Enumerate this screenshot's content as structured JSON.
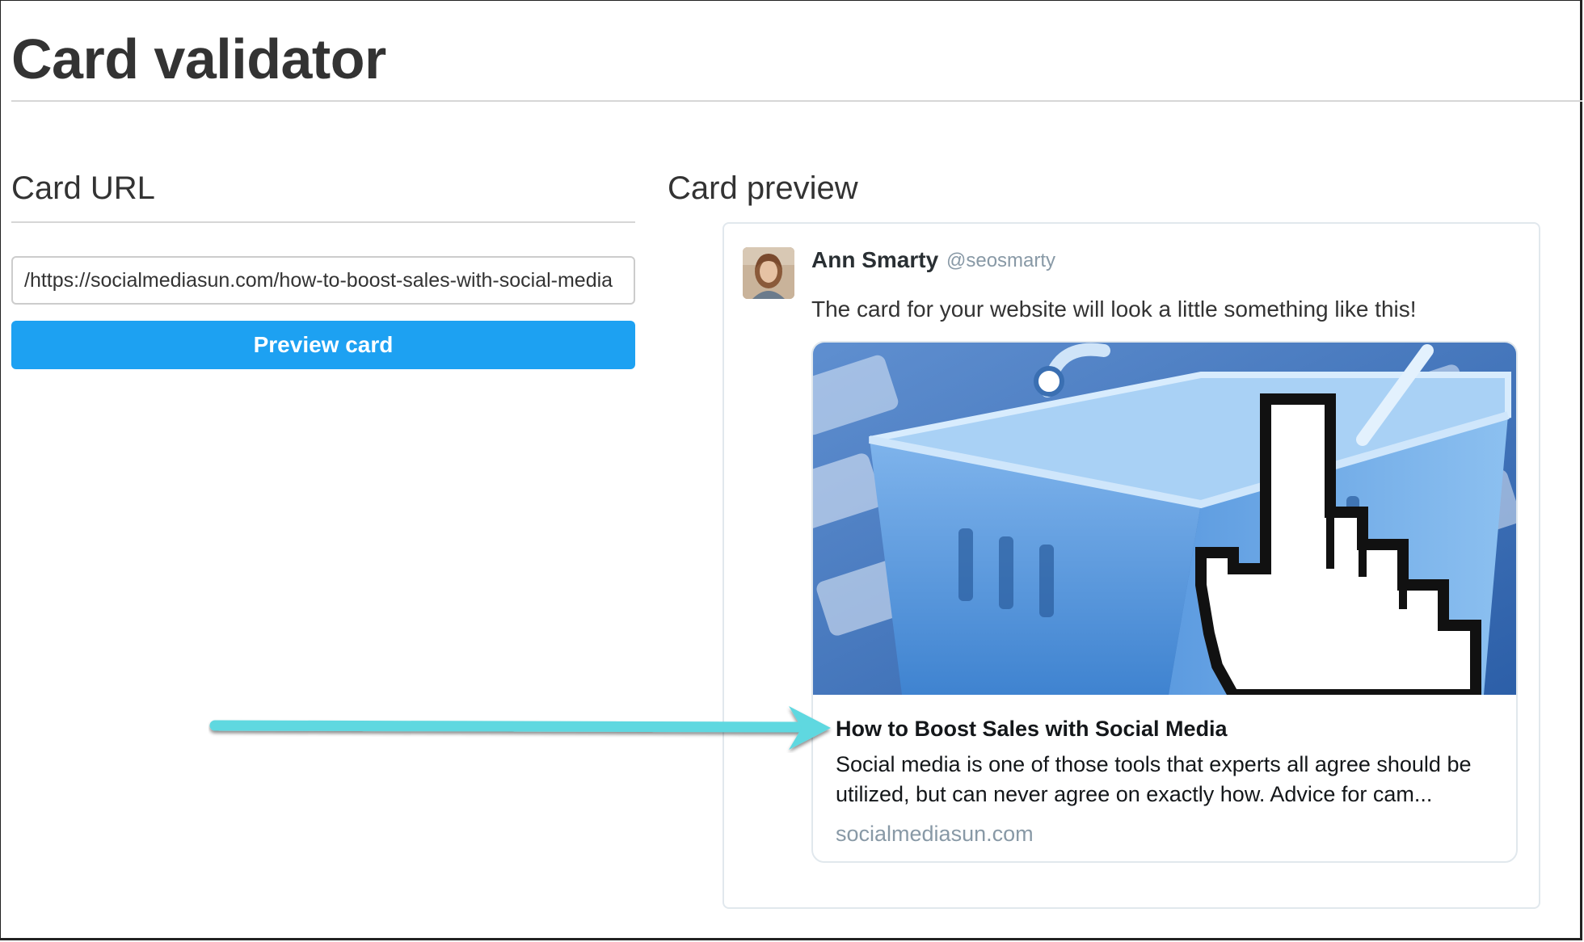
{
  "page": {
    "title": "Card validator"
  },
  "card_url": {
    "heading": "Card URL",
    "input_value": "https://socialmediasun.com/how-to-boost-sales-with-social-media/",
    "button_label": "Preview card"
  },
  "card_preview": {
    "heading": "Card preview",
    "tweet": {
      "author_name": "Ann Smarty",
      "author_handle": "@seosmarty",
      "text": "The card for your website will look a little something like this!"
    },
    "link_card": {
      "title": "How to Boost Sales with Social Media",
      "description": "Social media is one of those tools that experts all agree should be utilized, but can never agree on exactly how. Advice for cam...",
      "domain": "socialmediasun.com"
    }
  },
  "colors": {
    "button_blue": "#1da1f2",
    "annotation_arrow": "#5ed8e0",
    "basket_blue": "#4a8fd6"
  },
  "icons": {
    "card_image": "shopping-basket-with-hand-cursor",
    "annotation": "arrow-pointing-right"
  }
}
